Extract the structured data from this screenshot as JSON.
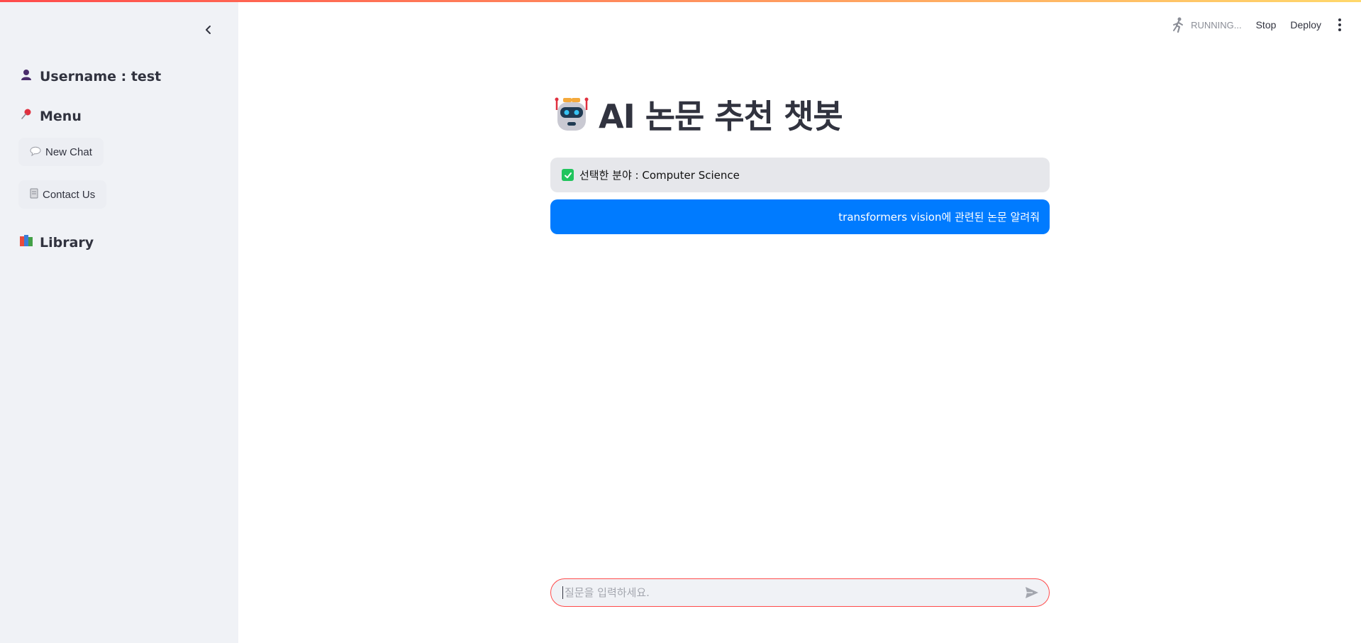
{
  "sidebar": {
    "username_label": "Username : test",
    "menu_title": "Menu",
    "new_chat_label": "New Chat",
    "contact_label": "Contact Us",
    "library_title": "Library",
    "icons": {
      "user": "person-silhouette-icon",
      "menu": "pushpin-icon",
      "new_chat": "speech-bubble-icon",
      "contact": "page-icon",
      "library": "books-icon",
      "collapse": "chevron-left-icon"
    }
  },
  "header": {
    "status_label": "RUNNING...",
    "stop_label": "Stop",
    "deploy_label": "Deploy"
  },
  "main": {
    "title": "AI 논문 추천 챗봇",
    "selected_field_text": "선택한 분야 : Computer Science",
    "user_message": "transformers vision에 관련된 논문 알려줘"
  },
  "chat_input": {
    "placeholder": "질문을 입력하세요."
  },
  "colors": {
    "accent": "#ff4b4b",
    "user_bubble": "#007bff",
    "sidebar_bg": "#f0f2f6",
    "check_green": "#21c45d"
  }
}
